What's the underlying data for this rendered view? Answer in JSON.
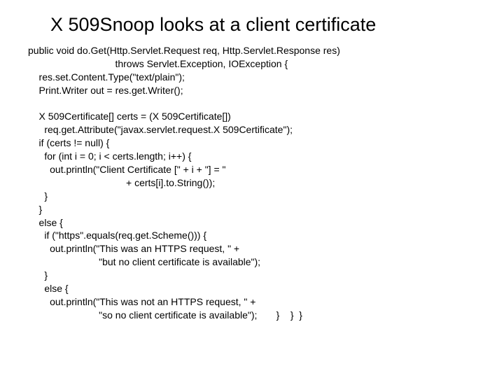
{
  "title": "X 509Snoop looks at a client certificate",
  "code": "public void do.Get(Http.Servlet.Request req, Http.Servlet.Response res)\n                                throws Servlet.Exception, IOException {\n    res.set.Content.Type(\"text/plain\");\n    Print.Writer out = res.get.Writer();\n\n    X 509Certificate[] certs = (X 509Certificate[])\n      req.get.Attribute(\"javax.servlet.request.X 509Certificate\");\n    if (certs != null) {\n      for (int i = 0; i < certs.length; i++) {\n        out.println(\"Client Certificate [\" + i + \"] = \"\n                                    + certs[i].to.String());\n      }\n    }\n    else {\n      if (\"https\".equals(req.get.Scheme())) {\n        out.println(\"This was an HTTPS request, \" +\n                          \"but no client certificate is available\");\n      }\n      else {\n        out.println(\"This was not an HTTPS request, \" +\n                          \"so no client certificate is available\");       }    }  }"
}
